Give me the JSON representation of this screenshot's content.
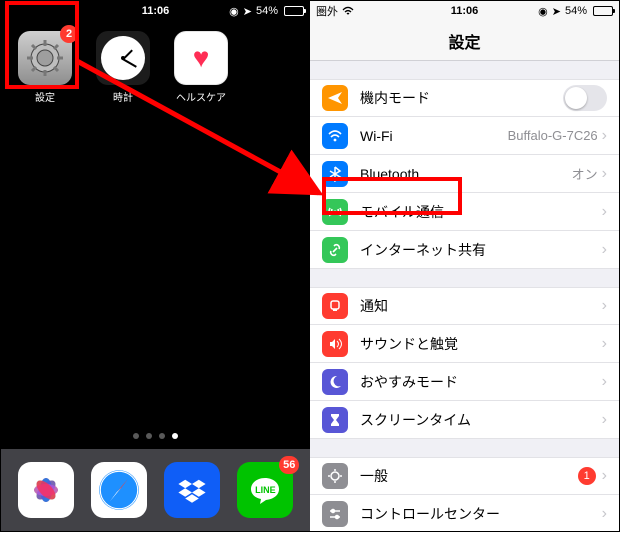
{
  "left": {
    "status": {
      "time": "11:06",
      "gps": "◉",
      "nav": "➤",
      "battery_pct": "54%",
      "battery_fill": 54
    },
    "apps": [
      {
        "id": "settings",
        "label": "設定",
        "badge": "2"
      },
      {
        "id": "clock",
        "label": "時計"
      },
      {
        "id": "health",
        "label": "ヘルスケア"
      }
    ],
    "page_dots": {
      "count": 4,
      "active_index": 3
    },
    "dock": [
      {
        "id": "photos"
      },
      {
        "id": "safari"
      },
      {
        "id": "dropbox"
      },
      {
        "id": "line",
        "label": "LINE",
        "badge": "56"
      }
    ]
  },
  "right": {
    "status": {
      "carrier": "圏外",
      "time": "11:06",
      "battery_pct": "54%",
      "battery_fill": 54
    },
    "title": "設定",
    "sections": [
      [
        {
          "icon": "airplane",
          "bg": "bg-orange",
          "label": "機内モード",
          "type": "toggle",
          "on": false
        },
        {
          "icon": "wifi",
          "bg": "bg-blue",
          "label": "Wi-Fi",
          "detail": "Buffalo-G-7C26"
        },
        {
          "icon": "bluetooth",
          "bg": "bg-blue",
          "label": "Bluetooth",
          "detail": "オン"
        },
        {
          "icon": "antenna",
          "bg": "bg-green",
          "label": "モバイル通信"
        },
        {
          "icon": "link",
          "bg": "bg-green",
          "label": "インターネット共有"
        }
      ],
      [
        {
          "icon": "bell",
          "bg": "bg-red",
          "label": "通知"
        },
        {
          "icon": "speaker",
          "bg": "bg-red",
          "label": "サウンドと触覚"
        },
        {
          "icon": "moon",
          "bg": "bg-purple",
          "label": "おやすみモード"
        },
        {
          "icon": "hourglass",
          "bg": "bg-purple",
          "label": "スクリーンタイム"
        }
      ],
      [
        {
          "icon": "gear",
          "bg": "bg-gray",
          "label": "一般",
          "badge": "1"
        },
        {
          "icon": "switches",
          "bg": "bg-gray",
          "label": "コントロールセンター"
        }
      ]
    ]
  }
}
